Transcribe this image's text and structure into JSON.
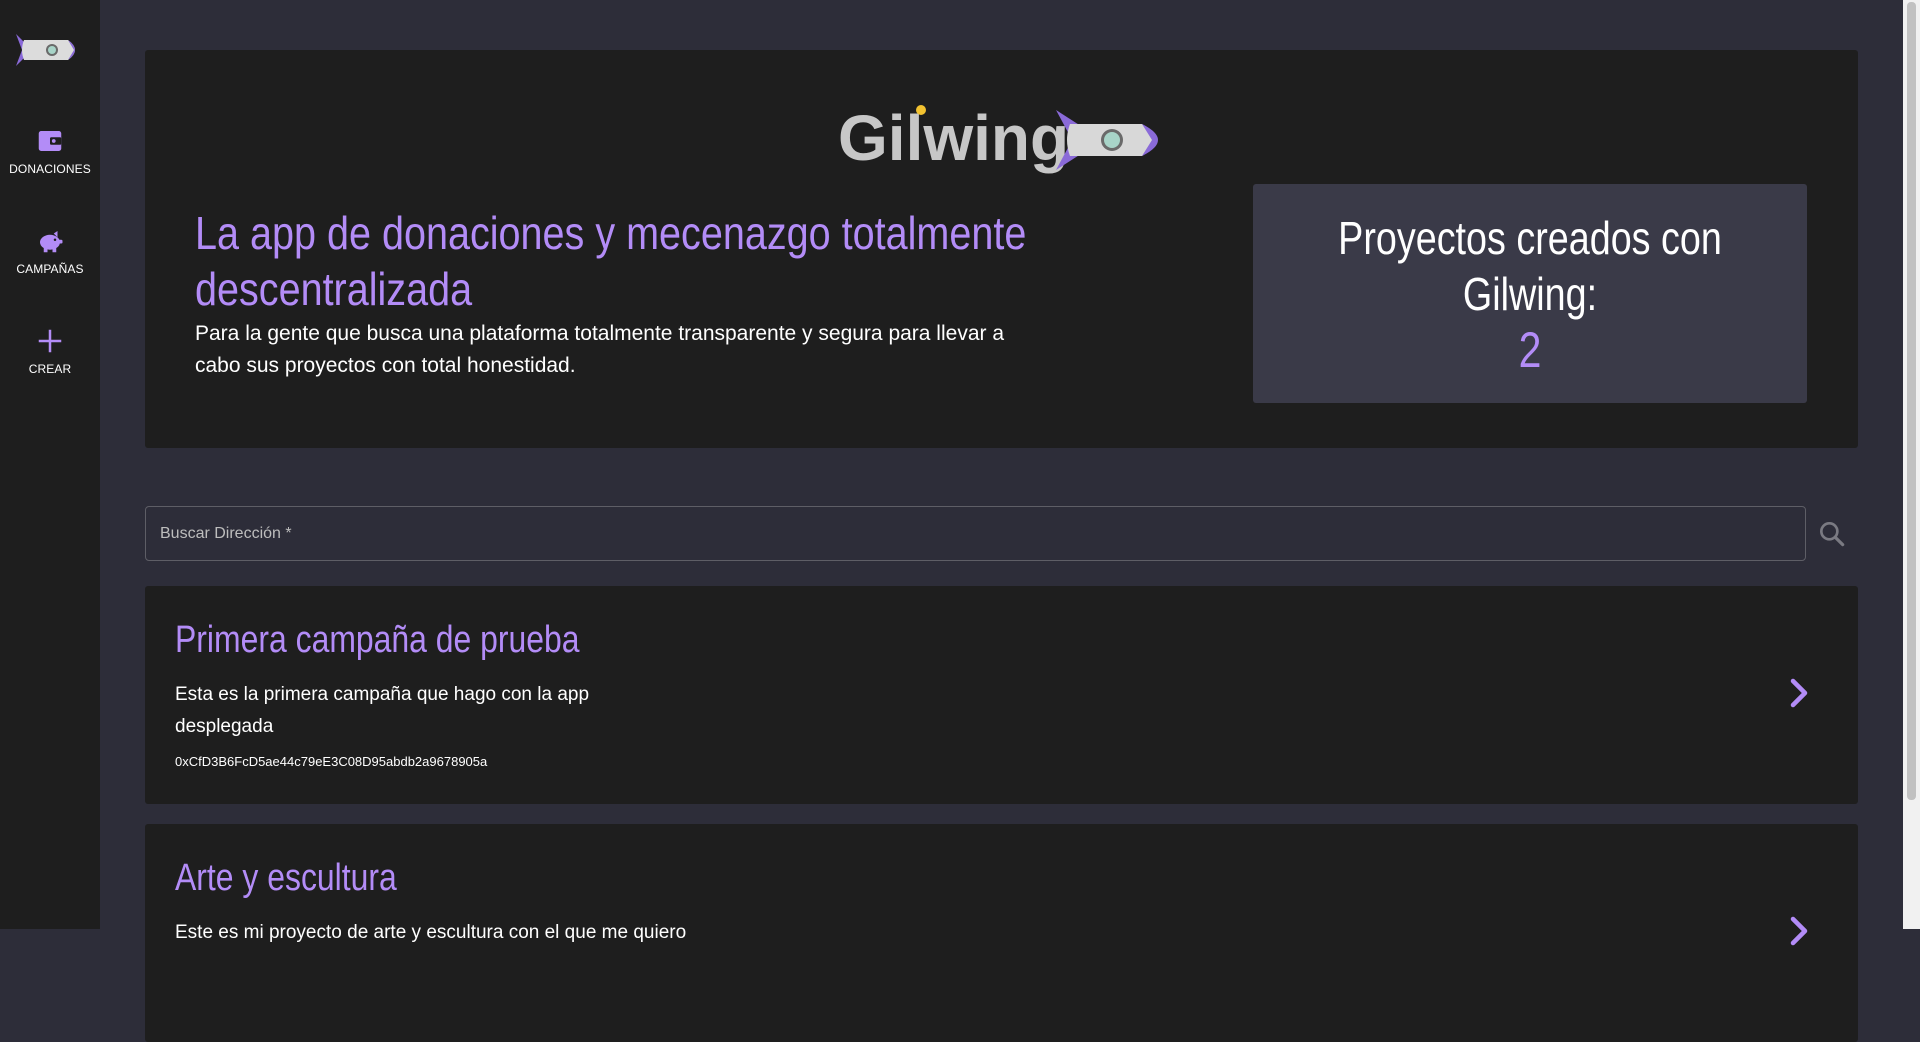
{
  "sidebar": {
    "items": [
      {
        "label": "DONACIONES",
        "icon": "wallet-icon"
      },
      {
        "label": "CAMPAÑAS",
        "icon": "piggy-bank-icon"
      },
      {
        "label": "CREAR",
        "icon": "plus-icon"
      }
    ]
  },
  "hero": {
    "brand": "Gilwing",
    "headline": "La app de donaciones y mecenazgo totalmente descentralizada",
    "subline": "Para la gente que busca una plataforma totalmente transparente y segura para llevar a cabo sus proyectos con total honestidad.",
    "stats_title": "Proyectos creados con Gilwing:",
    "stats_value": "2"
  },
  "search": {
    "placeholder": "Buscar Dirección *"
  },
  "campaigns": [
    {
      "title": "Primera campaña de prueba",
      "description": "Esta es la primera campaña que hago con la app desplegada",
      "address": "0xCfD3B6FcD5ae44c79eE3C08D95abdb2a9678905a"
    },
    {
      "title": "Arte y escultura",
      "description": "Este es mi proyecto de arte y escultura con el que me quiero",
      "address": ""
    }
  ],
  "colors": {
    "accent": "#b38cf7",
    "page_bg": "#2d2d39",
    "panel_bg": "#1e1e1e",
    "stats_bg": "#3a3a48"
  }
}
